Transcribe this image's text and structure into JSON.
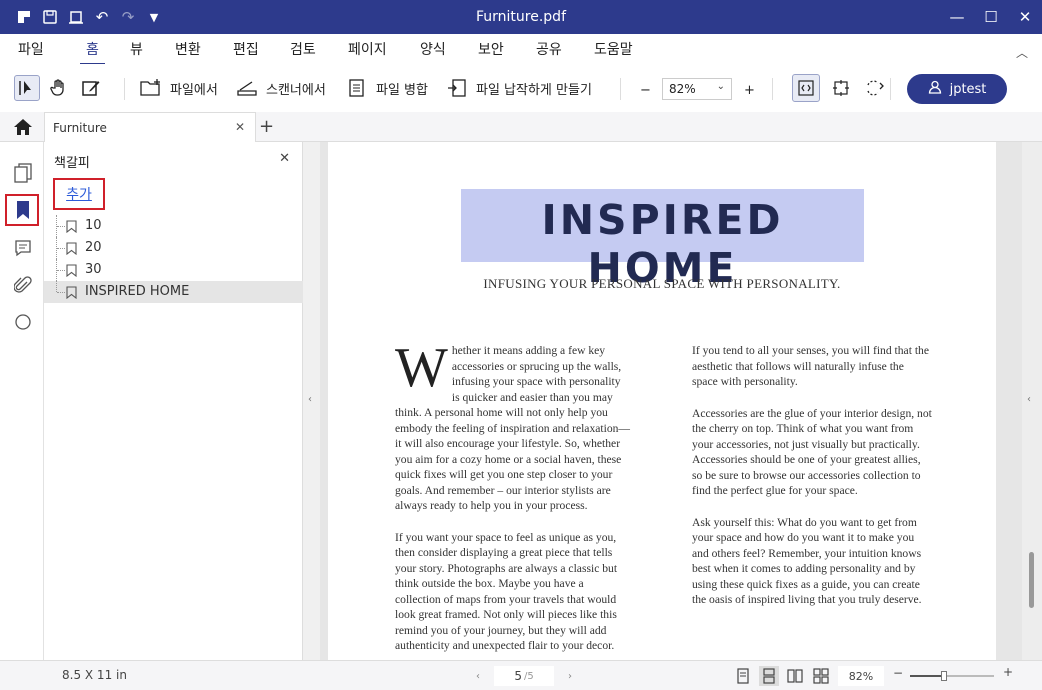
{
  "window": {
    "title": "Furniture.pdf"
  },
  "menu": {
    "items": [
      "파일",
      "홈",
      "뷰",
      "변환",
      "편집",
      "검토",
      "페이지",
      "양식",
      "보안",
      "공유",
      "도움말"
    ],
    "active": "홈"
  },
  "toolbar": {
    "from_file_label": "파일에서",
    "from_scanner_label": "스캔너에서",
    "merge_label": "파일 병합",
    "optimize_label": "파일 납작하게 만들기",
    "zoom_value": "82%",
    "zoom_minus": "−",
    "zoom_plus": "+",
    "user_name": "jptest"
  },
  "tabs": {
    "doc_tab_label": "Furniture"
  },
  "bookmark_panel": {
    "title": "책갈피",
    "add_label": "추가",
    "items": [
      {
        "label": "10",
        "selected": false
      },
      {
        "label": "20",
        "selected": false
      },
      {
        "label": "30",
        "selected": false
      },
      {
        "label": "INSPIRED HOME",
        "selected": true
      }
    ]
  },
  "document": {
    "heading": "INSPIRED HOME",
    "subheading": "INFUSING YOUR PERSONAL SPACE WITH PERSONALITY.",
    "left_col": {
      "dropcap": "W",
      "para1": "hether it means adding a few key accessories or sprucing up the walls, infusing your space with personality is quicker and easier than you may think. A personal home will not only help you embody the feeling of inspiration and relaxation—it will also encourage your lifestyle. So, whether you aim for a cozy home or a social haven, these quick fixes will get you one step closer to your goals. And remember – our interior stylists are always ready to help you in your process.",
      "para2": "If you want your space to feel as unique as you, then consider displaying a great piece that tells your story. Photographs are always a classic but think outside the box. Maybe you have a collection of maps from your travels that would look great framed. Not only will pieces like this remind you of your journey, but they will add authenticity and unexpected flair to your decor."
    },
    "right_col": {
      "para1": "If you tend to all your senses, you will find that the aesthetic that follows will naturally infuse the space with personality.",
      "para2": "Accessories are the glue of your interior design, not the cherry on top. Think of what you want from your accessories, not just visually but practically. Accessories should be one of your greatest allies, so be sure to browse our accessories collection to find the perfect glue for your space.",
      "para3": "Ask yourself this: What do you want to get from your space and how do you want it to make you and others feel? Remember, your intuition knows best when it comes to adding personality and by using these quick fixes as a guide, you can create the oasis of inspired living that you truly deserve."
    },
    "highlight_color": "#c5cbf2"
  },
  "status": {
    "page_size": "8.5 X 11 in",
    "current_page": "5",
    "total_pages": "/5",
    "zoom": "82%",
    "zoom_fraction": 0.41
  },
  "colors": {
    "accent": "#2d3a8c",
    "annotation_red": "#d0202a",
    "link_blue": "#2d5bd8"
  }
}
